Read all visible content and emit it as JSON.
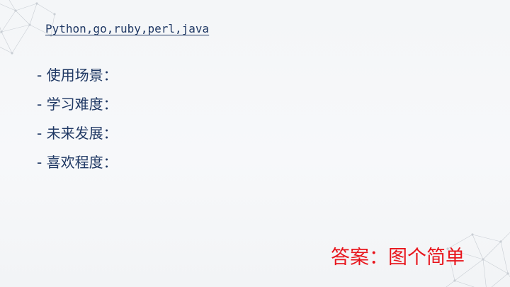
{
  "slide": {
    "subtitle": "Python,go,ruby,perl,java",
    "bullets": [
      "- 使用场景：",
      "- 学习难度：",
      "- 未来发展：",
      "- 喜欢程度："
    ],
    "answer": "答案：图个简单",
    "colors": {
      "text": "#1f3864",
      "answer": "#e8141b",
      "background": "#f5f7f9",
      "decoration": "#c9ced4"
    },
    "decorations": [
      "network-mesh-icon",
      "network-mesh-icon"
    ]
  }
}
